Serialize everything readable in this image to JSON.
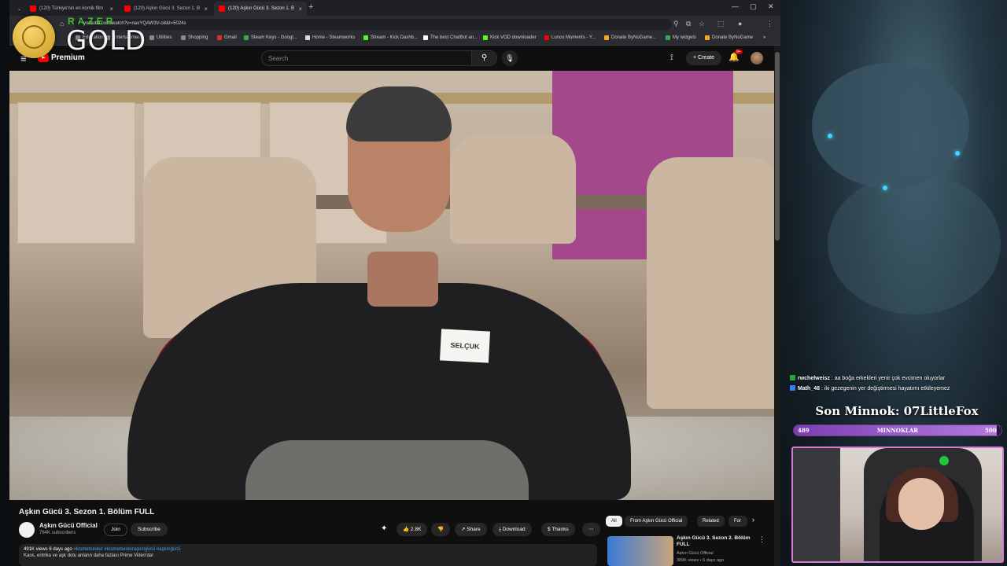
{
  "browser": {
    "tabs": [
      {
        "title": "(120) Türkiye'nin en komik film"
      },
      {
        "title": "(120) Aşkın Gücü 3. Sezon 1. B"
      },
      {
        "title": "(120) Aşkın Gücü 3. Sezon 1. B"
      }
    ],
    "url": "youtube.com/watch?v=naxYQAW3V-o8&t=5024s",
    "bookmarks": [
      "Education",
      "Entertainment",
      "Utilities",
      "Shopping",
      "Gmail",
      "Steam Keys - Googl...",
      "Home - Steamworks",
      "Stream - Kick Dashb...",
      "The best ChatBot an...",
      "Kick VOD downloader",
      "Lunox Moments - Y...",
      "Donate ByNoGame...",
      "My widgets",
      "Donate ByNoGame"
    ]
  },
  "overlay": {
    "razer": "RAZER",
    "gold": "GOLD"
  },
  "youtube": {
    "logo_text": "Premium",
    "search_placeholder": "Search",
    "create_label": "Create",
    "bell_badge": "9+",
    "name_tag": "SELÇUK",
    "video_title": "Aşkın Gücü 3. Sezon 1. Bölüm FULL",
    "channel_name": "Aşkın Gücü Official",
    "channel_subs": "764K subscribers",
    "join_label": "Join",
    "subscribe_label": "Subscribe",
    "like_count": "2.8K",
    "share_label": "Share",
    "download_label": "Download",
    "thanks_label": "Thanks",
    "desc_stats": "491K views  6 days ago",
    "desc_tags": "#kısmetseolur #kısmetseoluraşkıngücü #aşkıngücü",
    "desc_text": "Kaos, entrika ve aşk dolu anların daha fazlası Prime Video'da!",
    "chips": [
      "All",
      "From Aşkın Gücü Official",
      "Related",
      "For"
    ],
    "rec_title": "Aşkın Gücü 3. Sezon 2. Bölüm FULL",
    "rec_channel": "Aşkın Gücü Official",
    "rec_meta": "389K views • 6 days ago"
  },
  "stream": {
    "chat": [
      {
        "user": "rwchelweisz",
        "text": "aa boğa erkekleri yenir çok evcimen oluyorlar"
      },
      {
        "user": "Math_48",
        "text": "iki gezegenin yer değiştirmesi hayatımı etkileyemez"
      }
    ],
    "last_sub": "Son Minnok: 07LittleFox",
    "goal_label": "MINNOKLAR",
    "goal_current": "489",
    "goal_max": "500",
    "goal_fraction": 0.978
  },
  "icons": [
    "menu-icon",
    "search-icon",
    "mic-icon",
    "cast-icon",
    "bell-icon",
    "sparkle-icon",
    "like-icon",
    "dislike-icon",
    "share-icon",
    "download-icon",
    "thanks-icon",
    "more-icon"
  ]
}
